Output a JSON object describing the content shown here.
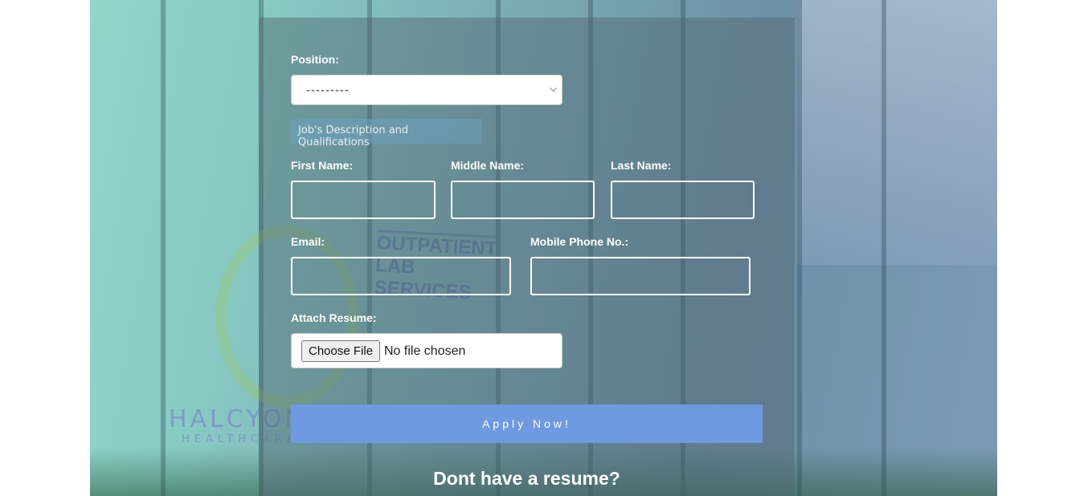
{
  "form": {
    "position_label": "Position:",
    "position_value": "---------",
    "description_button": "Job's Description and Qualifications",
    "first_name_label": "First Name:",
    "middle_name_label": "Middle Name:",
    "last_name_label": "Last Name:",
    "email_label": "Email:",
    "mobile_label": "Mobile Phone No.:",
    "resume_label": "Attach Resume:",
    "choose_file": "Choose File",
    "no_file": "No file chosen",
    "apply_button": "Apply Now!"
  },
  "footer": {
    "no_resume_heading": "Dont have a resume?"
  },
  "background": {
    "brand": "HALCYON",
    "brand_sub": "HEALTHCARE",
    "sign": "OUTPATIENT LAB SERVICES"
  },
  "colors": {
    "apply_button": "#6f99e0",
    "panel_overlay": "rgba(80,100,110,0.45)"
  },
  "icons": {
    "select_chevron": "chevron-down-icon"
  }
}
